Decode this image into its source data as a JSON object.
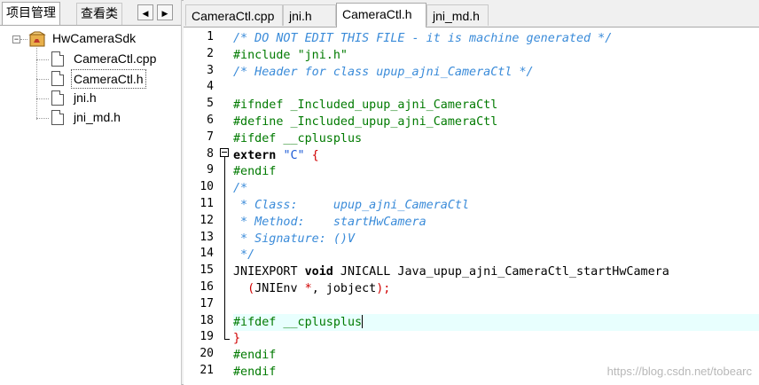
{
  "left_panel": {
    "tabs": [
      "项目管理",
      "查看类"
    ],
    "nav": {
      "prev": "◀",
      "next": "▶"
    },
    "tree": {
      "project": "HwCameraSdk",
      "files": [
        "CameraCtl.cpp",
        "CameraCtl.h",
        "jni.h",
        "jni_md.h"
      ],
      "selected_index": 1
    }
  },
  "editor": {
    "tabs": [
      "CameraCtl.cpp",
      "jni.h",
      "CameraCtl.h",
      "jni_md.h"
    ],
    "active_tab_index": 2,
    "line_numbers": [
      "1",
      "2",
      "3",
      "4",
      "5",
      "6",
      "7",
      "8",
      "9",
      "10",
      "11",
      "12",
      "13",
      "14",
      "15",
      "16",
      "17",
      "18",
      "19",
      "20",
      "21"
    ],
    "lines": [
      [
        {
          "t": "/* DO NOT EDIT THIS FILE - it is machine generated */",
          "c": "cmt"
        }
      ],
      [
        {
          "t": "#include ",
          "c": "pp"
        },
        {
          "t": "\"jni.h\"",
          "c": "pp"
        }
      ],
      [
        {
          "t": "/* Header for class upup_ajni_CameraCtl */",
          "c": "cmt"
        }
      ],
      [],
      [
        {
          "t": "#ifndef _Included_upup_ajni_CameraCtl",
          "c": "pp"
        }
      ],
      [
        {
          "t": "#define _Included_upup_ajni_CameraCtl",
          "c": "pp"
        }
      ],
      [
        {
          "t": "#ifdef __cplusplus",
          "c": "pp"
        }
      ],
      [
        {
          "t": "extern ",
          "c": "kw"
        },
        {
          "t": "\"C\"",
          "c": "str"
        },
        {
          "t": " {",
          "c": "red"
        }
      ],
      [
        {
          "t": "#endif",
          "c": "pp"
        }
      ],
      [
        {
          "t": "/*",
          "c": "cmt"
        }
      ],
      [
        {
          "t": " * Class:     upup_ajni_CameraCtl",
          "c": "cmt"
        }
      ],
      [
        {
          "t": " * Method:    startHwCamera",
          "c": "cmt"
        }
      ],
      [
        {
          "t": " * Signature: ()V",
          "c": "cmt"
        }
      ],
      [
        {
          "t": " */",
          "c": "cmt"
        }
      ],
      [
        {
          "t": "JNIEXPORT ",
          "c": "txt"
        },
        {
          "t": "void",
          "c": "kw"
        },
        {
          "t": " JNICALL Java_upup_ajni_CameraCtl_startHwCamera",
          "c": "txt"
        }
      ],
      [
        {
          "t": "  (",
          "c": "red"
        },
        {
          "t": "JNIEnv ",
          "c": "txt"
        },
        {
          "t": "*",
          "c": "red"
        },
        {
          "t": ", jobject",
          "c": "txt"
        },
        {
          "t": ");",
          "c": "red"
        }
      ],
      [],
      [
        {
          "t": "#ifdef __cplusplus",
          "c": "pp"
        }
      ],
      [
        {
          "t": "}",
          "c": "red"
        }
      ],
      [
        {
          "t": "#endif",
          "c": "pp"
        }
      ],
      [
        {
          "t": "#endif",
          "c": "pp"
        }
      ]
    ],
    "highlight_line": 18,
    "watermark": "https://blog.csdn.net/tobearc"
  }
}
